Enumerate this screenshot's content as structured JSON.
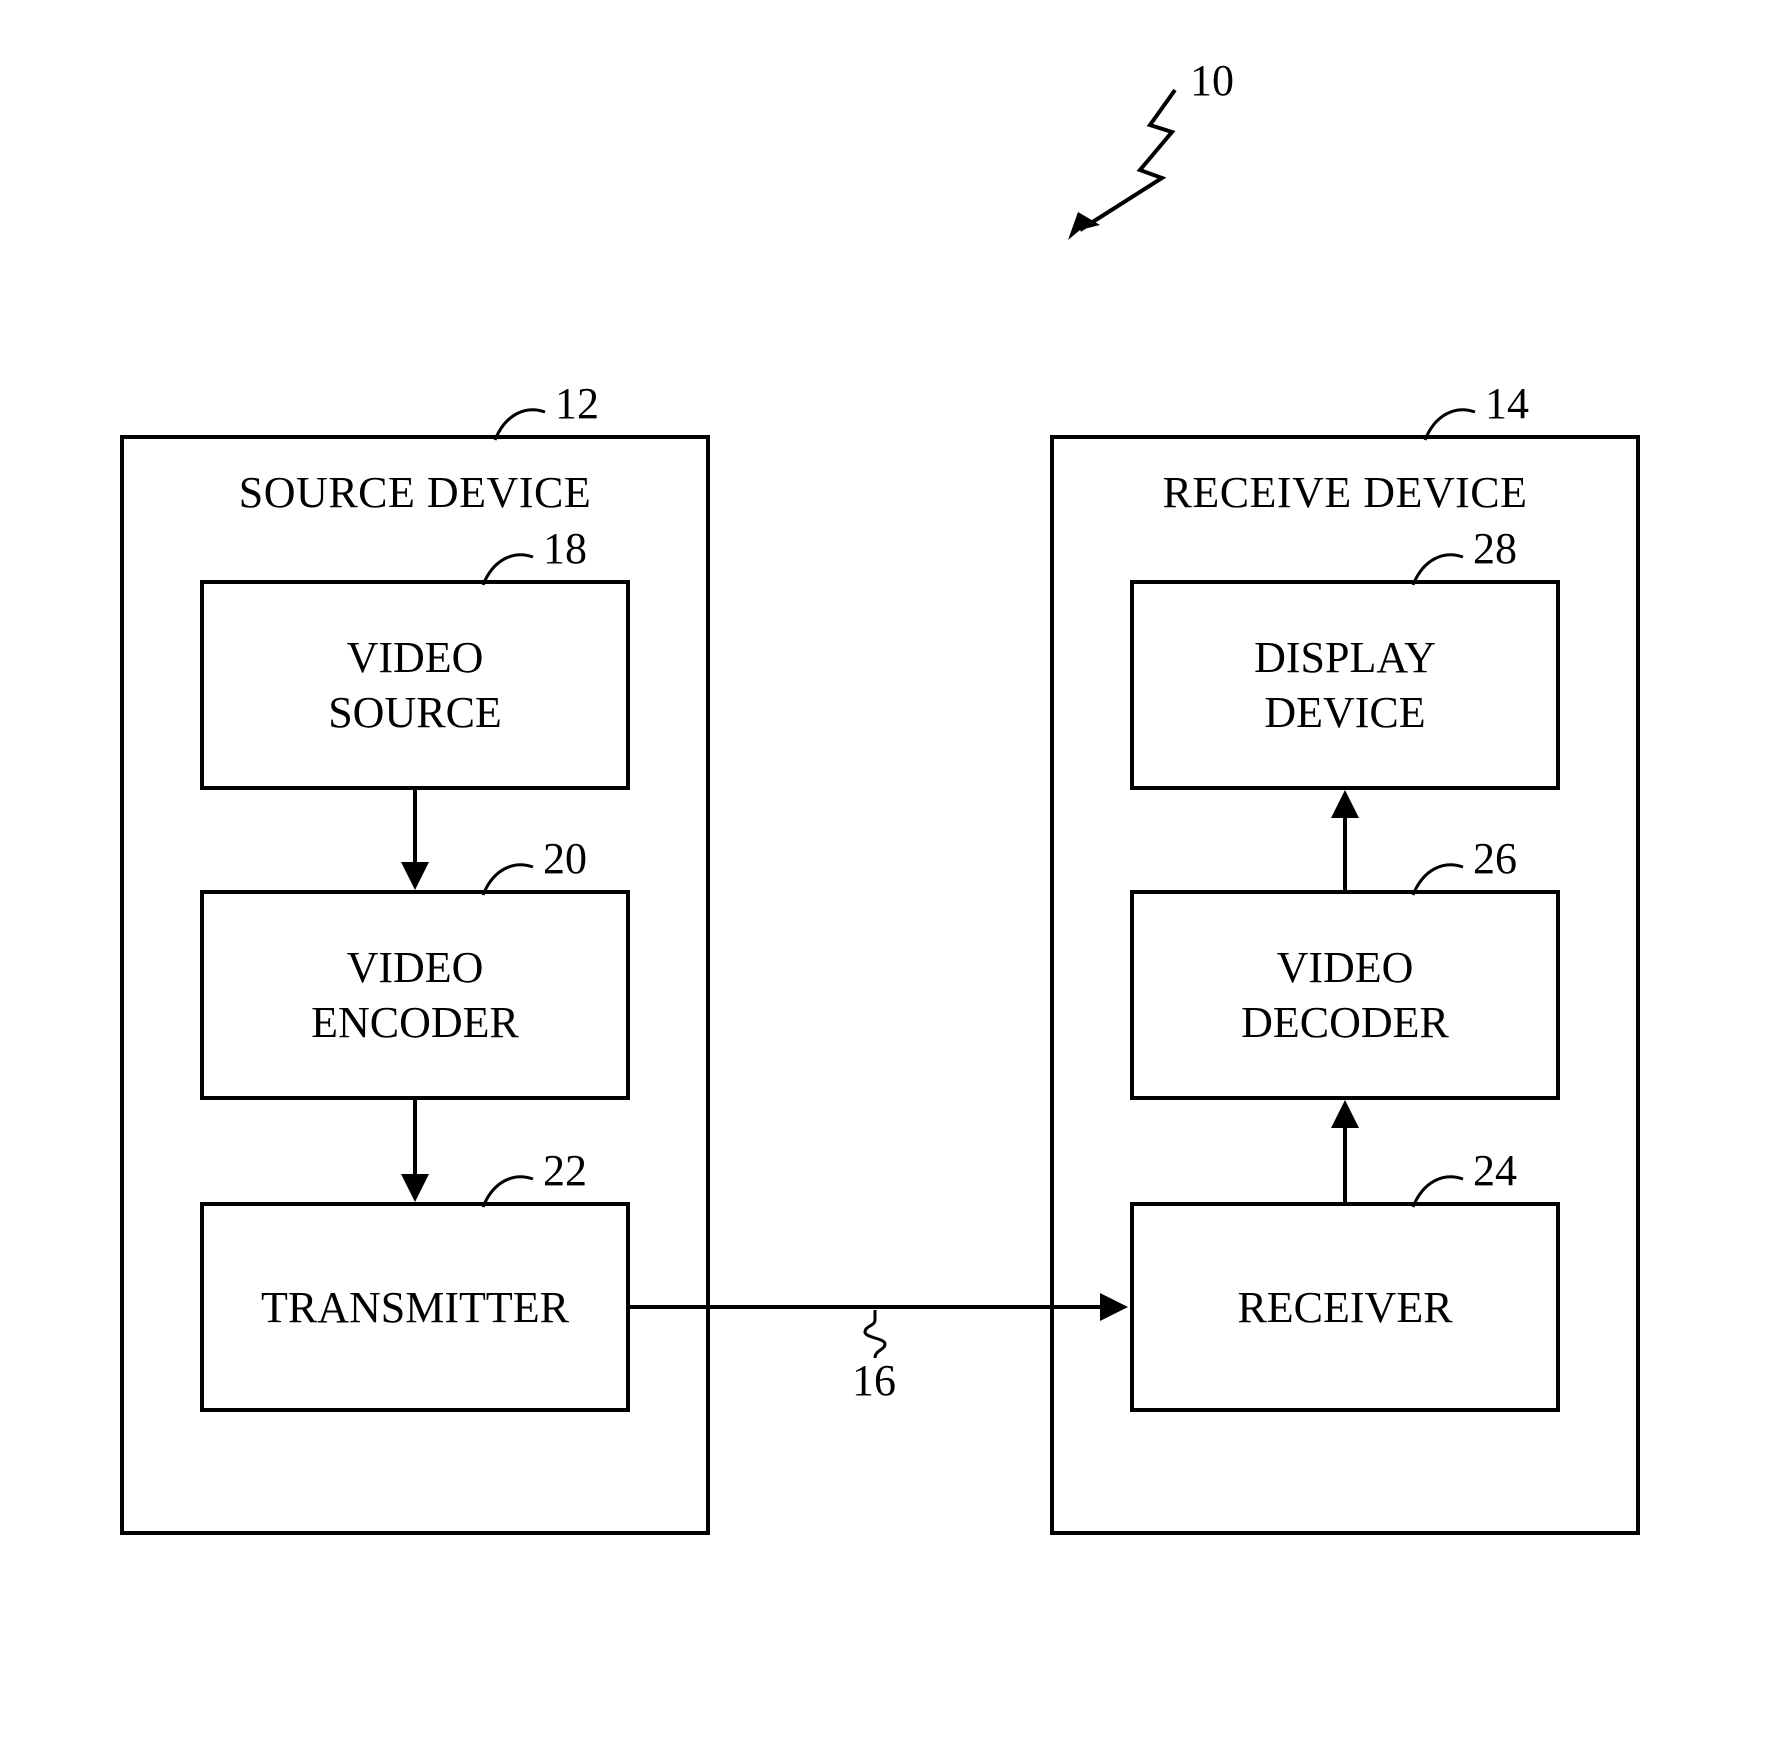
{
  "refs": {
    "system": "10",
    "source_device": "12",
    "receive_device": "14",
    "link": "16",
    "video_source": "18",
    "video_encoder": "20",
    "transmitter": "22",
    "receiver": "24",
    "video_decoder": "26",
    "display_device": "28"
  },
  "titles": {
    "source_device": "SOURCE DEVICE",
    "receive_device": "RECEIVE DEVICE"
  },
  "blocks": {
    "video_source": "VIDEO\nSOURCE",
    "video_encoder": "VIDEO\nENCODER",
    "transmitter": "TRANSMITTER",
    "display_device": "DISPLAY\nDEVICE",
    "video_decoder": "VIDEO\nDECODER",
    "receiver": "RECEIVER"
  }
}
